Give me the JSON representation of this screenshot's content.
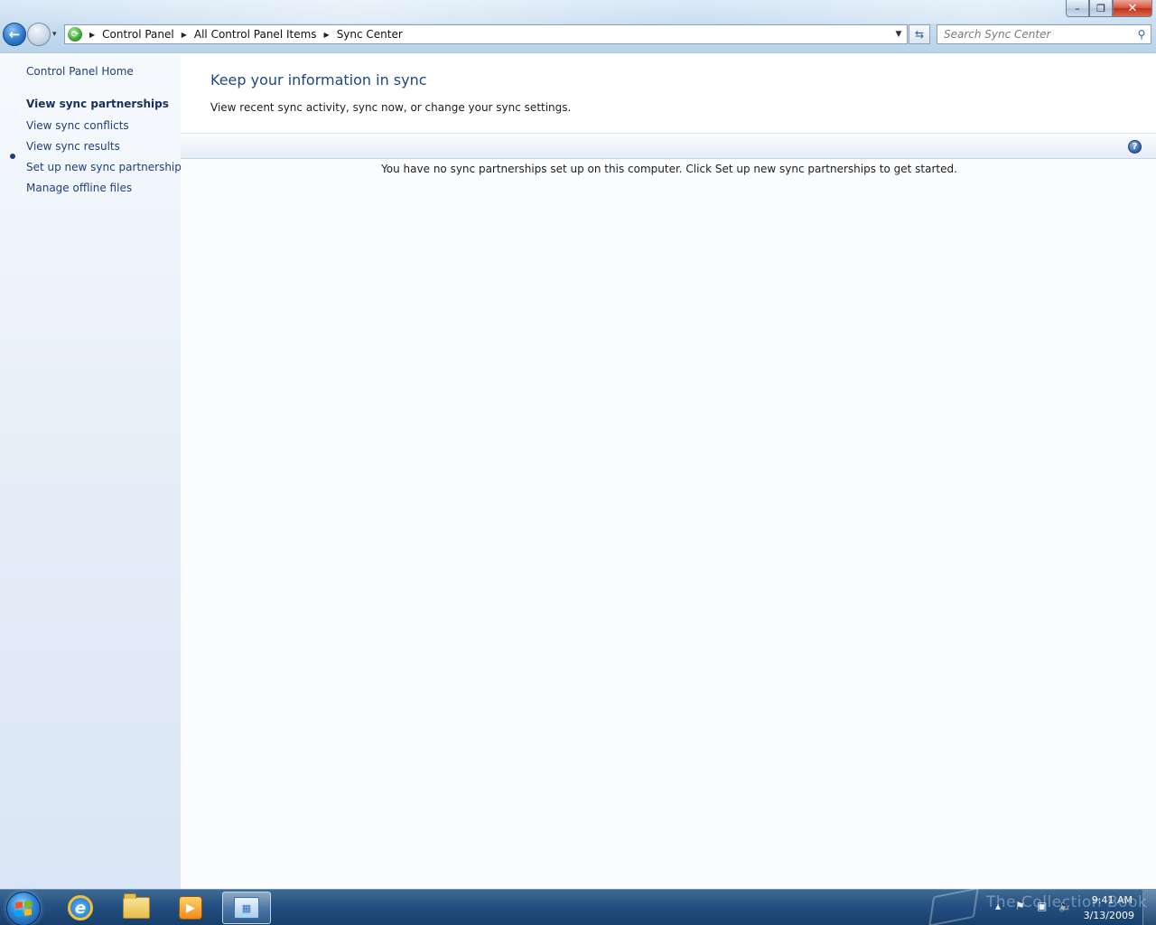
{
  "window": {
    "controls": {
      "minimize": "–",
      "maximize": "❐",
      "close": "✕"
    }
  },
  "navigation": {
    "back_glyph": "←",
    "forward_glyph": "→",
    "recent_glyph": "▾"
  },
  "address_bar": {
    "breadcrumbs": [
      "Control Panel",
      "All Control Panel Items",
      "Sync Center"
    ],
    "separator_glyph": "▶",
    "dropdown_glyph": "▼",
    "refresh_glyph": "⇆",
    "icon": "sync-center-icon"
  },
  "search": {
    "placeholder": "Search Sync Center",
    "icon": "search-icon"
  },
  "left_pane": {
    "home_link": "Control Panel Home",
    "tasks": [
      {
        "label": "View sync partnerships",
        "active": true
      },
      {
        "label": "View sync conflicts",
        "active": false
      },
      {
        "label": "View sync results",
        "active": false
      },
      {
        "label": "Set up new sync partnerships",
        "active": false
      },
      {
        "label": "Manage offline files",
        "active": false
      }
    ]
  },
  "main": {
    "title": "Keep your information in sync",
    "subtitle": "View recent sync activity, sync now, or change your sync settings.",
    "help_glyph": "?",
    "empty_message": "You have no sync partnerships set up on this computer. Click Set up new sync partnerships to get started."
  },
  "taskbar": {
    "pinned": [
      "internet-explorer-icon",
      "windows-explorer-icon",
      "media-player-icon",
      "control-panel-icon"
    ],
    "active_app": "control-panel-icon",
    "watermark": "The Collection Book",
    "clock": {
      "time": "9:41 AM",
      "date": "3/13/2009"
    }
  },
  "colors": {
    "link": "#1e3f77",
    "title": "#1d4787",
    "taskbar": "#245082",
    "close_button": "#c1301a"
  }
}
